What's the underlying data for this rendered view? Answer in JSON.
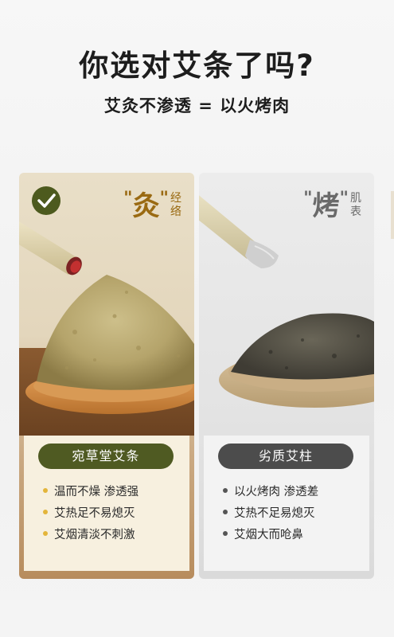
{
  "header": {
    "title": "你选对艾条了吗?",
    "subtitle": "艾灸不渗透 = 以火烤肉"
  },
  "good": {
    "tag_char": "灸",
    "tag_text": "经络",
    "product": "宛草堂艾条",
    "features": [
      "温而不燥 渗透强",
      "艾热足不易熄灭",
      "艾烟清淡不刺激"
    ],
    "accent": "#4f5a22",
    "bullet_color": "#e3b53a"
  },
  "bad": {
    "tag_char": "烤",
    "tag_text": "肌表",
    "product": "劣质艾柱",
    "features": [
      "以火烤肉 渗透差",
      "艾热不足易熄灭",
      "艾烟大而呛鼻"
    ],
    "accent": "#4c4c4c"
  },
  "icons": [
    "check-icon",
    "moxa-stick-burning",
    "moxa-powder-on-spoon"
  ]
}
